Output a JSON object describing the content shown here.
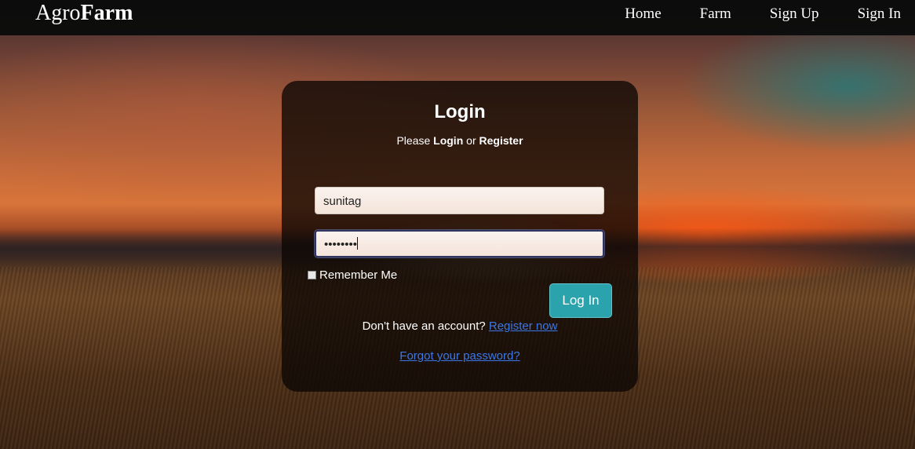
{
  "navbar": {
    "brand_light": "Agro",
    "brand_bold": "Farm",
    "links": [
      {
        "label": "Home"
      },
      {
        "label": "Farm"
      },
      {
        "label": "Sign Up"
      },
      {
        "label": "Sign In"
      }
    ]
  },
  "login": {
    "title": "Login",
    "subtitle_prefix": "Please ",
    "subtitle_login": "Login",
    "subtitle_or": " or ",
    "subtitle_register": "Register",
    "username_value": "sunitag",
    "password_masked": "••••••••",
    "remember_label": "Remember Me",
    "submit_label": "Log In",
    "no_account_text": "Don't have an account? ",
    "register_link": "Register now",
    "forgot_link": "Forgot your password?"
  },
  "colors": {
    "accent": "#2aa3ad",
    "link": "#3c77e6",
    "navbar_bg": "#080a0a"
  }
}
